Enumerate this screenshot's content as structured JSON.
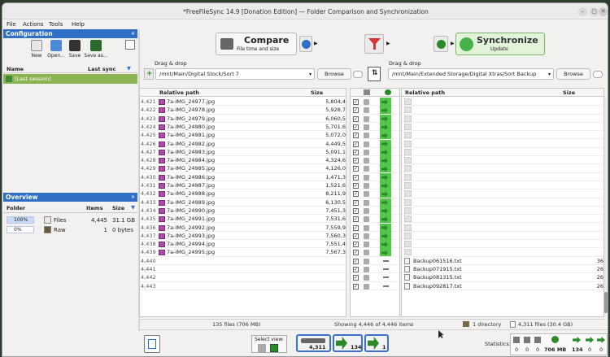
{
  "window": {
    "title": "*FreeFileSync 14.9 [Donation Edition] — Folder Comparison and Synchronization"
  },
  "menu": [
    "File",
    "Actions",
    "Tools",
    "Help"
  ],
  "config": {
    "header": "Configuration",
    "buttons": [
      "New",
      "Open...",
      "Save",
      "Save as..."
    ],
    "columns": {
      "name": "Name",
      "last_sync": "Last sync"
    },
    "item": "[Last session]"
  },
  "toolbar": {
    "compare_label": "Compare",
    "compare_sub": "File time and size",
    "sync_label": "Synchronize",
    "sync_sub": "Update"
  },
  "left": {
    "dragdrop": "Drag & drop",
    "path": "/mnt/Main/Digital Stock/Sort 7",
    "browse": "Browse",
    "col_path": "Relative path",
    "col_size": "Size",
    "status": "135 files (706 MB)"
  },
  "right": {
    "dragdrop": "Drag & drop",
    "path": "/mnt/Main/Extended Storage/Digital Xtras/Sort Backup",
    "browse": "Browse",
    "col_path": "Relative path",
    "col_size": "Size",
    "status_dirs": "1 directory",
    "status_files": "4,311 files (30.4 GB)"
  },
  "middle": {
    "status": "Showing 4,446 of 4,446 items"
  },
  "rows": [
    {
      "num": "4,421",
      "name": "7a-IMG_24977.jpg",
      "size": "5,804,4"
    },
    {
      "num": "4,422",
      "name": "7a-IMG_24978.jpg",
      "size": "5,928,7"
    },
    {
      "num": "4,423",
      "name": "7a-IMG_24979.jpg",
      "size": "6,060,5"
    },
    {
      "num": "4,424",
      "name": "7a-IMG_24980.jpg",
      "size": "5,701,6"
    },
    {
      "num": "4,425",
      "name": "7a-IMG_24981.jpg",
      "size": "5,072,0"
    },
    {
      "num": "4,426",
      "name": "7a-IMG_24982.jpg",
      "size": "4,449,5"
    },
    {
      "num": "4,427",
      "name": "7a-IMG_24983.jpg",
      "size": "5,091,1"
    },
    {
      "num": "4,428",
      "name": "7a-IMG_24984.jpg",
      "size": "4,324,6"
    },
    {
      "num": "4,429",
      "name": "7a-IMG_24985.jpg",
      "size": "4,126,0"
    },
    {
      "num": "4,430",
      "name": "7a-IMG_24986.jpg",
      "size": "1,471,3"
    },
    {
      "num": "4,431",
      "name": "7a-IMG_24987.jpg",
      "size": "1,521,6"
    },
    {
      "num": "4,432",
      "name": "7a-IMG_24988.jpg",
      "size": "8,211,9"
    },
    {
      "num": "4,433",
      "name": "7a-IMG_24989.jpg",
      "size": "6,130,5"
    },
    {
      "num": "4,434",
      "name": "7a-IMG_24990.jpg",
      "size": "7,451,3"
    },
    {
      "num": "4,435",
      "name": "7a-IMG_24991.jpg",
      "size": "7,531,6"
    },
    {
      "num": "4,436",
      "name": "7a-IMG_24992.jpg",
      "size": "7,559,9"
    },
    {
      "num": "4,437",
      "name": "7a-IMG_24993.jpg",
      "size": "7,560,3"
    },
    {
      "num": "4,438",
      "name": "7a-IMG_24994.jpg",
      "size": "7,551,4"
    },
    {
      "num": "4,439",
      "name": "7a-IMG_24995.jpg",
      "size": "7,567,3"
    },
    {
      "num": "4,440",
      "name": "",
      "size": ""
    },
    {
      "num": "4,441",
      "name": "",
      "size": ""
    },
    {
      "num": "4,442",
      "name": "",
      "size": ""
    },
    {
      "num": "4,443",
      "name": "",
      "size": ""
    }
  ],
  "right_rows": [
    {
      "name": "Backup061516.txt",
      "size": "36"
    },
    {
      "name": "Backup071915.txt",
      "size": "26"
    },
    {
      "name": "Backup081315.txt",
      "size": "26"
    },
    {
      "name": "Backup092817.txt",
      "size": "26"
    }
  ],
  "overview": {
    "header": "Overview",
    "columns": {
      "folder": "Folder",
      "items": "Items",
      "size": "Size"
    },
    "rows": [
      {
        "pct": "100%",
        "name": "Files",
        "items": "4,445",
        "size": "31.1 GB",
        "fill": 1.0
      },
      {
        "pct": "0%",
        "name": "Raw",
        "items": "1",
        "size": "0 bytes",
        "fill": 0.0
      }
    ]
  },
  "bottom": {
    "select_view": "Select view:",
    "count1": "4,311",
    "count2": "134",
    "count3": "1",
    "statistics": "Statistics:",
    "stats": [
      "0",
      "0",
      "0",
      "706 MB",
      "134",
      "0",
      "0"
    ]
  }
}
